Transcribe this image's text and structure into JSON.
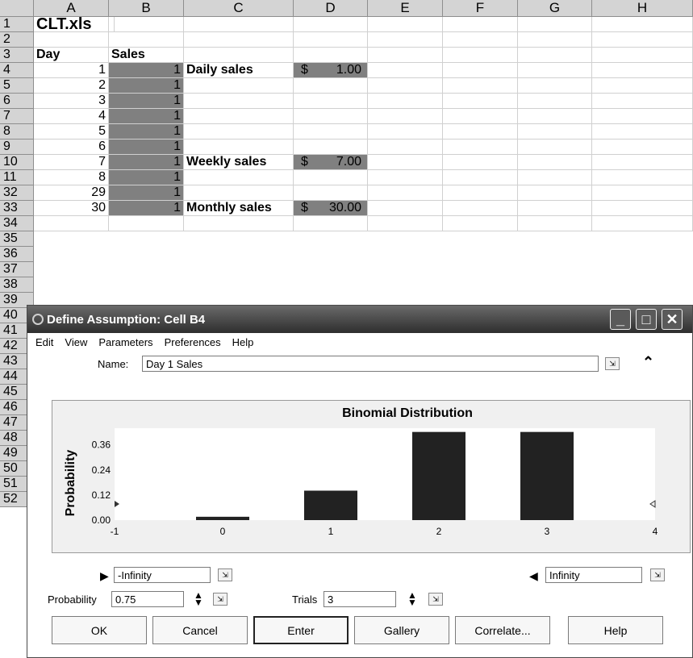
{
  "spreadsheet": {
    "columns": [
      "A",
      "B",
      "C",
      "D",
      "E",
      "F",
      "G",
      "H"
    ],
    "rows": [
      "1",
      "2",
      "3",
      "4",
      "5",
      "6",
      "7",
      "8",
      "9",
      "10",
      "11",
      "32",
      "33",
      "34",
      "35",
      "36",
      "37",
      "38",
      "39",
      "40",
      "41",
      "42",
      "43",
      "44",
      "45",
      "46",
      "47",
      "48",
      "49",
      "50",
      "51",
      "52"
    ],
    "title": "CLT.xls",
    "header_day": "Day",
    "header_sales": "Sales",
    "days": [
      "1",
      "2",
      "3",
      "4",
      "5",
      "6",
      "7",
      "8",
      "29",
      "30"
    ],
    "sales": [
      "1",
      "1",
      "1",
      "1",
      "1",
      "1",
      "1",
      "1",
      "1",
      "1"
    ],
    "daily_label": "Daily sales",
    "weekly_label": "Weekly sales",
    "monthly_label": "Monthly sales",
    "currency": "$",
    "daily_value": "1.00",
    "weekly_value": "7.00",
    "monthly_value": "30.00"
  },
  "dialog": {
    "title": "Define Assumption: Cell B4",
    "menu": [
      "Edit",
      "View",
      "Parameters",
      "Preferences",
      "Help"
    ],
    "name_label": "Name:",
    "name_value": "Day 1 Sales",
    "left_bound": "-Infinity",
    "right_bound": "Infinity",
    "probability_label": "Probability",
    "probability_value": "0.75",
    "trials_label": "Trials",
    "trials_value": "3",
    "buttons": [
      "OK",
      "Cancel",
      "Enter",
      "Gallery",
      "Correlate...",
      "Help"
    ]
  },
  "chart_data": {
    "type": "bar",
    "title": "Binomial Distribution",
    "ylabel": "Probability",
    "x_ticks": [
      "-1",
      "0",
      "1",
      "2",
      "3",
      "4"
    ],
    "y_ticks": [
      "0.00",
      "0.12",
      "0.24",
      "0.36"
    ],
    "xlim": [
      -1,
      4
    ],
    "ylim": [
      0,
      0.44
    ],
    "categories": [
      "0",
      "1",
      "2",
      "3"
    ],
    "values": [
      0.016,
      0.141,
      0.422,
      0.422
    ],
    "bar_color": "#222222"
  }
}
